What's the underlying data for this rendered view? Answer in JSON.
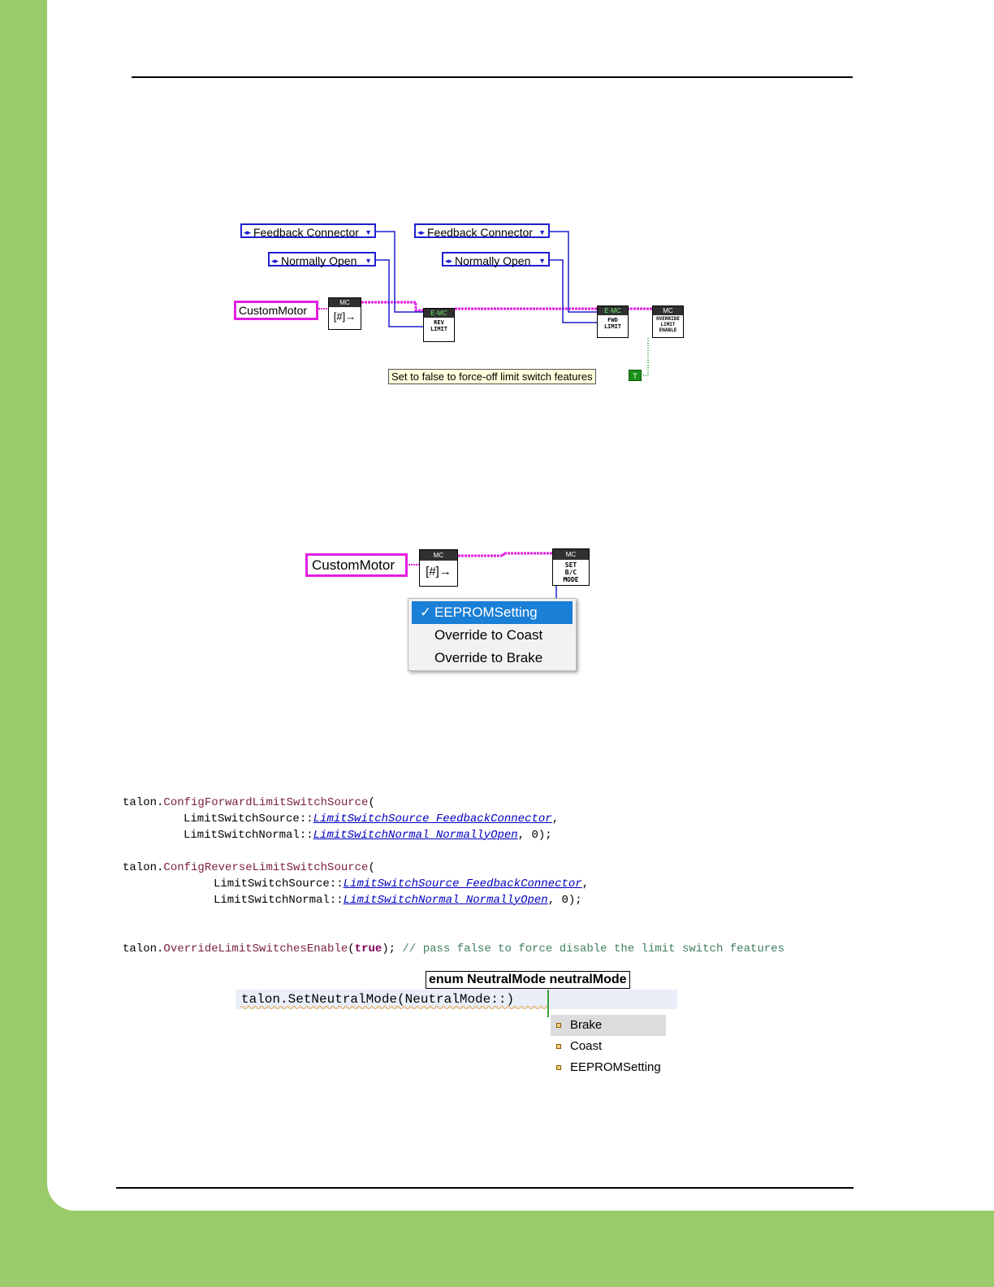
{
  "labview_limit": {
    "fwd_source": "Feedback Connector",
    "fwd_normal": "Normally Open",
    "rev_source": "Feedback Connector",
    "rev_normal": "Normally Open",
    "class_label": "CustomMotor",
    "open_vi_header": "MC",
    "open_vi_glyph": "#",
    "rev_vi_header": "E-MC",
    "rev_vi_body": "REV\nLIMIT",
    "fwd_vi_header": "E-MC",
    "fwd_vi_body": "FWD\nLIMIT",
    "override_vi_header": "MC",
    "override_vi_body": "OVERRIDE\nLIMIT\nENABLE",
    "tooltip": "Set to false to force-off limit switch features",
    "bool_label": "T"
  },
  "labview_neutral": {
    "class_label": "CustomMotor",
    "open_vi_header": "MC",
    "open_vi_glyph": "#",
    "set_vi_header": "MC",
    "set_vi_body": "SET\nB/C\nMODE",
    "menu_items": [
      {
        "label": "EEPROMSetting",
        "checked": true,
        "check": "✓"
      },
      {
        "label": "Override to Coast"
      },
      {
        "label": "Override to Brake"
      }
    ]
  },
  "code": {
    "line1_obj": "talon.",
    "line1_method": "ConfigForwardLimitSwitchSource",
    "line1_tail": "(",
    "line2_ns": "LimitSwitchSource::",
    "line2_enum": "LimitSwitchSource_FeedbackConnector",
    "line2_tail": ",",
    "line3_ns": "LimitSwitchNormal::",
    "line3_enum": "LimitSwitchNormal_NormallyOpen",
    "line3_tail": ", 0);",
    "line4_obj": "talon.",
    "line4_method": "ConfigReverseLimitSwitchSource",
    "line4_tail": "(",
    "line5_ns": "LimitSwitchSource::",
    "line5_enum": "LimitSwitchSource_FeedbackConnector",
    "line5_tail": ",",
    "line6_ns": "LimitSwitchNormal::",
    "line6_enum": "LimitSwitchNormal_NormallyOpen",
    "line6_tail": ", 0);",
    "line7_obj": "talon.",
    "line7_method": "OverrideLimitSwitchesEnable",
    "line7_open": "(",
    "line7_kw": "true",
    "line7_close": "); ",
    "line7_comment": "// pass false to force disable the limit switch features"
  },
  "ide": {
    "tooltip": "enum NeutralMode neutralMode",
    "line": "talon.SetNeutralMode(NeutralMode::",
    "cursor_char": ")",
    "items": [
      "Brake",
      "Coast",
      "EEPROMSetting"
    ]
  },
  "colors": {
    "background": "#9acb6a",
    "class_wire": "#e21ee2",
    "enum_wire": "#1f1fd1",
    "bool_wire": "#1a8f1a",
    "menu_selected": "#1a7fd6"
  }
}
